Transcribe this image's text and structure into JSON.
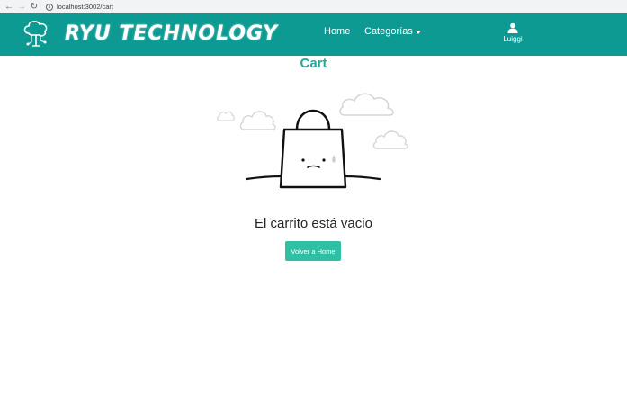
{
  "browser": {
    "url": "localhost:3002/cart",
    "info_icon": "i"
  },
  "navbar": {
    "brand": "RYU TECHNOLOGY",
    "home_label": "Home",
    "categorias_label": "Categorías",
    "user_name": "Luiggi",
    "background_color": "#0c9a92"
  },
  "cart": {
    "title": "Cart",
    "empty_message": "El carrito está vacio",
    "back_button_label": "Volver a Home",
    "accent_color": "#2aa69b",
    "button_color": "#2ebfa5"
  }
}
